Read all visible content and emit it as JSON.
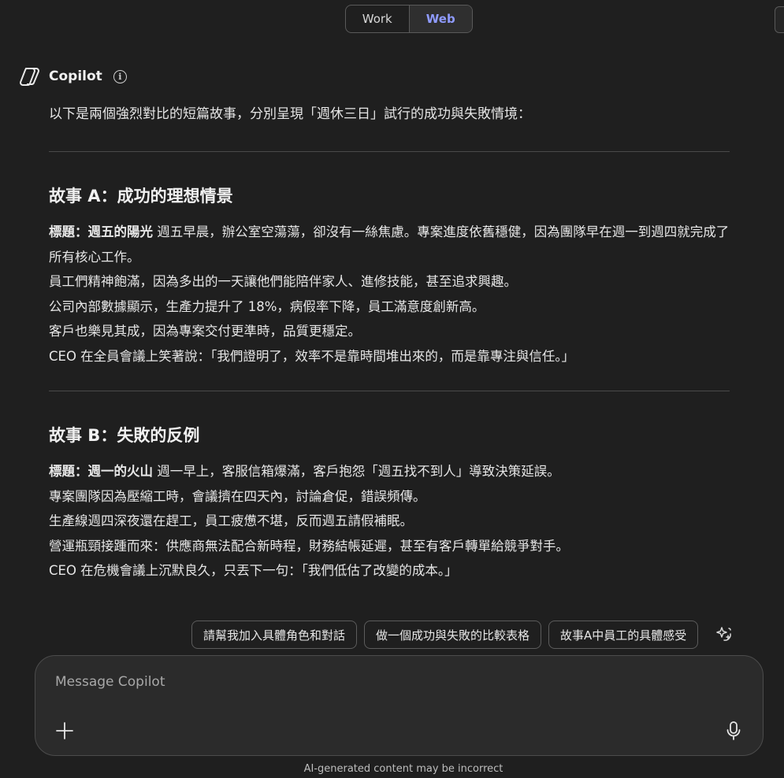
{
  "mode_toggle": {
    "work_label": "Work",
    "web_label": "Web",
    "selected": "Web"
  },
  "header": {
    "name": "Copilot"
  },
  "message": {
    "intro": "以下是兩個強烈對比的短篇故事，分別呈現「週休三日」試行的成功與失敗情境：",
    "story_a": {
      "title": "故事 A：成功的理想情景",
      "label": "標題：週五的陽光",
      "lines": [
        " 週五早晨，辦公室空蕩蕩，卻沒有一絲焦慮。專案進度依舊穩健，因為團隊早在週一到週四就完成了所有核心工作。",
        "員工們精神飽滿，因為多出的一天讓他們能陪伴家人、進修技能，甚至追求興趣。",
        "公司內部數據顯示，生產力提升了 18%，病假率下降，員工滿意度創新高。",
        "客戶也樂見其成，因為專案交付更準時，品質更穩定。",
        "CEO 在全員會議上笑著說：「我們證明了，效率不是靠時間堆出來的，而是靠專注與信任。」"
      ]
    },
    "story_b": {
      "title": "故事 B：失敗的反例",
      "label": "標題：週一的火山",
      "lines": [
        " 週一早上，客服信箱爆滿，客戶抱怨「週五找不到人」導致決策延誤。",
        "專案團隊因為壓縮工時，會議擠在四天內，討論倉促，錯誤頻傳。",
        "生產線週四深夜還在趕工，員工疲憊不堪，反而週五請假補眠。",
        "營運瓶頸接踵而來：供應商無法配合新時程，財務結帳延遲，甚至有客戶轉單給競爭對手。",
        "CEO 在危機會議上沉默良久，只丟下一句：「我們低估了改變的成本。」"
      ]
    }
  },
  "suggestions": [
    "請幫我加入具體角色和對話",
    "做一個成功與失敗的比較表格",
    "故事A中員工的具體感受"
  ],
  "composer": {
    "placeholder": "Message Copilot",
    "value": ""
  },
  "disclaimer": "AI-generated content may be incorrect",
  "colors": {
    "accent": "#8f9bff",
    "background": "#1f1f1f",
    "composer_bg": "#2b2b2b"
  }
}
